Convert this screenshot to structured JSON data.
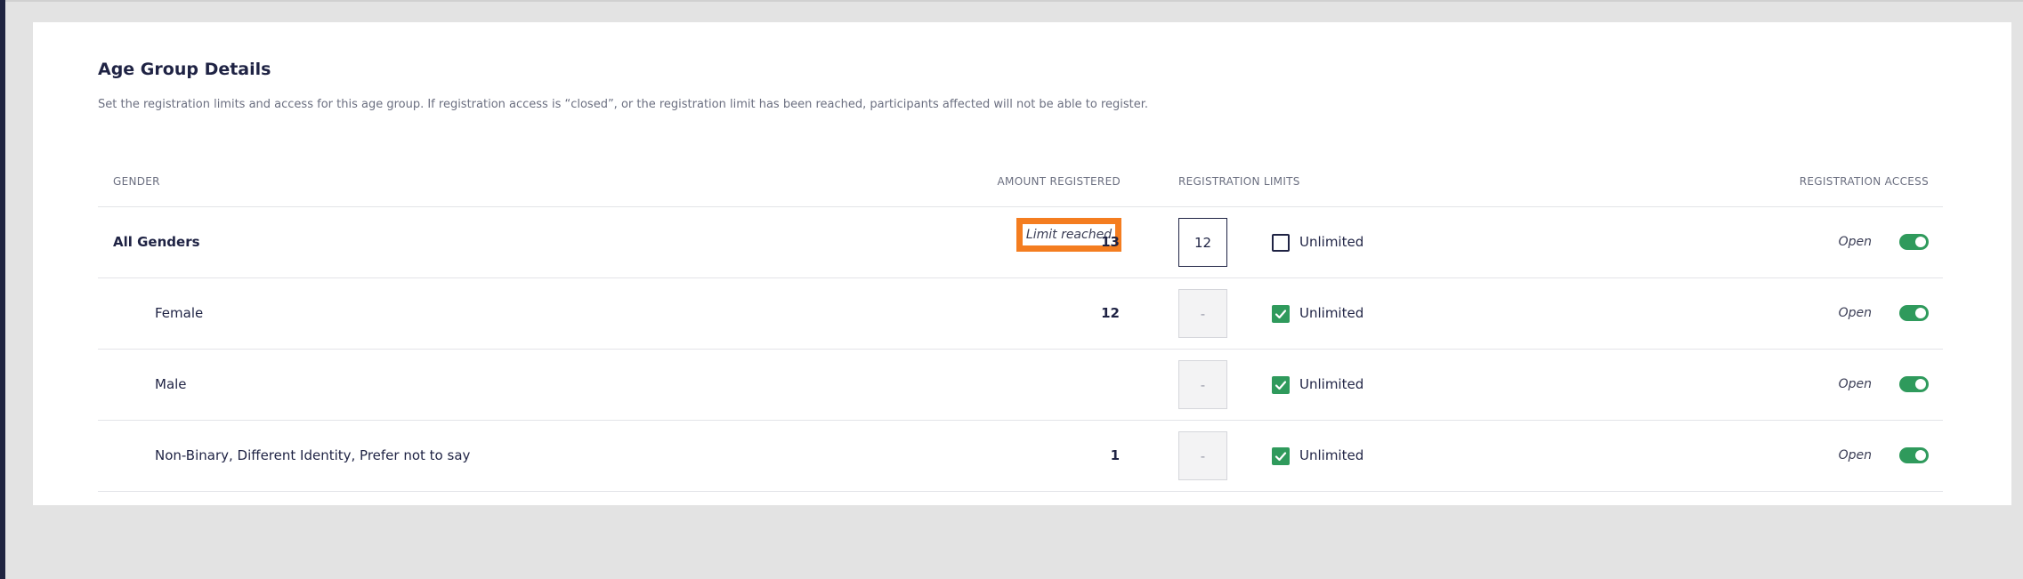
{
  "section": {
    "title": "Age Group Details",
    "description": "Set the registration limits and access for this age group. If registration access is “closed”, or the registration limit has been reached, participants affected will not be able to register."
  },
  "table": {
    "headers": {
      "gender": "GENDER",
      "amount_registered": "AMOUNT REGISTERED",
      "registration_limits": "REGISTRATION LIMITS",
      "registration_access": "REGISTRATION ACCESS"
    },
    "rows": [
      {
        "gender": "All Genders",
        "badge": "Limit reached",
        "amount": "13",
        "limit_value": "12",
        "unlimited_label": "Unlimited",
        "unlimited_checked": false,
        "access": "Open",
        "access_on": true
      },
      {
        "gender": "Female",
        "badge": "",
        "amount": "12",
        "limit_value": "-",
        "unlimited_label": "Unlimited",
        "unlimited_checked": true,
        "access": "Open",
        "access_on": true
      },
      {
        "gender": "Male",
        "badge": "",
        "amount": "",
        "limit_value": "-",
        "unlimited_label": "Unlimited",
        "unlimited_checked": true,
        "access": "Open",
        "access_on": true
      },
      {
        "gender": "Non-Binary, Different Identity, Prefer not to say",
        "badge": "",
        "amount": "1",
        "limit_value": "-",
        "unlimited_label": "Unlimited",
        "unlimited_checked": true,
        "access": "Open",
        "access_on": true
      }
    ]
  },
  "colors": {
    "accent_green": "#2f9a5c",
    "highlight_orange": "#f47d20",
    "navy": "#1f2344",
    "background": "#e3e3e3"
  },
  "icons": {
    "checkbox_checked": "check-icon",
    "toggle_on": "toggle-switch-icon"
  }
}
